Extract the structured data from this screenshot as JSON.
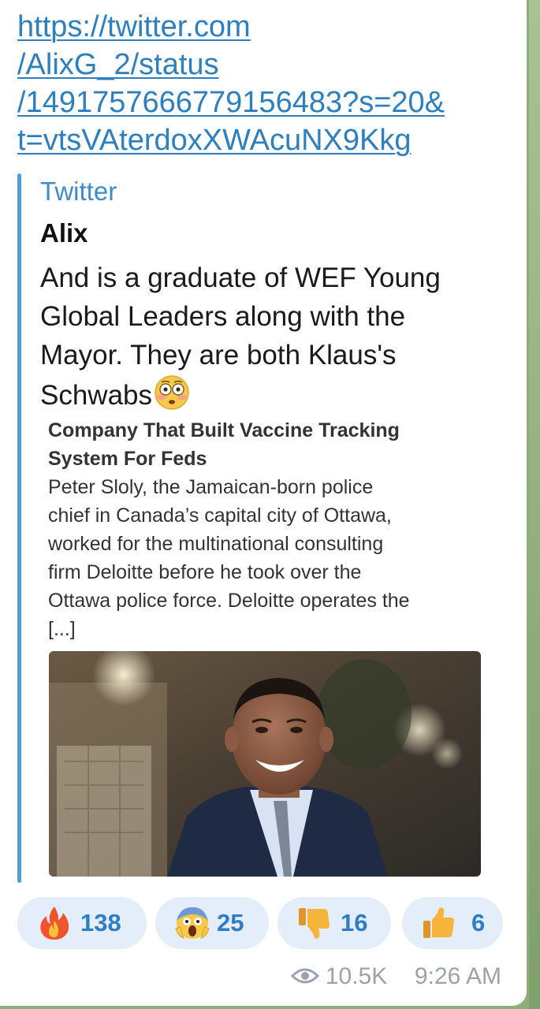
{
  "message": {
    "link_lines": [
      "https://twitter.com",
      "/AlixG_2/status",
      "/1491757666779156483?s=20&",
      "t=vtsVAterdoxXWAcuNX9Kkg"
    ],
    "preview": {
      "site_name": "Twitter",
      "author": "Alix",
      "text_lines": [
        "And is a graduate of WEF Young",
        "Global Leaders along with the",
        "Mayor. They are both Klaus's",
        "Schwabs"
      ],
      "emoji_icon": "flushed-face-icon",
      "article": {
        "title_lines": [
          "Company That Built Vaccine Tracking",
          "System For Feds"
        ],
        "body_lines": [
          "Peter Sloly, the Jamaican-born police",
          "chief in Canada’s capital city of Ottawa,",
          "worked for the multinational consulting",
          "firm Deloitte before he took over the",
          "Ottawa police force. Deloitte operates the",
          "[...]"
        ]
      }
    },
    "reactions": [
      {
        "icon": "fire-icon",
        "count": "138"
      },
      {
        "icon": "screaming-face-icon",
        "count": "25"
      },
      {
        "icon": "thumbs-down-icon",
        "count": "16"
      },
      {
        "icon": "thumbs-up-icon",
        "count": "6"
      }
    ],
    "views": "10.5K",
    "time": "9:26 AM"
  },
  "colors": {
    "link": "#2d7fc0",
    "accent": "#4f9ed6",
    "reaction_bg": "#e3eefa",
    "reaction_text": "#2f7dc4",
    "meta_text": "#9aa3ad",
    "chat_background": "#8fae7e"
  }
}
